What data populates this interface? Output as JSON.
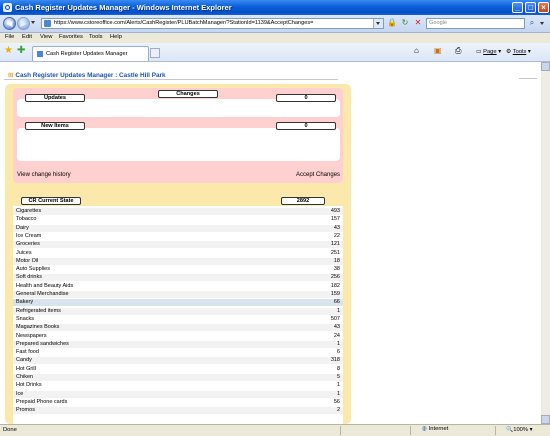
{
  "window": {
    "title": "Cash Register Updates Manager - Windows Internet Explorer"
  },
  "address": {
    "url": "https://www.cstoreoffice.com/Alerts/CashRegister/PLUBatchManager/?StationId=1139&AcceptChanges=",
    "search_placeholder": "Google"
  },
  "menu": [
    "File",
    "Edit",
    "View",
    "Favorites",
    "Tools",
    "Help"
  ],
  "tab": {
    "label": "Cash Register Updates Manager"
  },
  "commands": {
    "page": "Page",
    "tools": "Tools"
  },
  "page": {
    "title": "Cash Register Updates Manager : Castle Hill Park",
    "changes_label": "Changes",
    "updates_label": "Updates",
    "updates_count": "0",
    "new_items_label": "New Items",
    "new_items_count": "0",
    "view_history": "View change history",
    "accept_changes": "Accept Changes",
    "current_state_label": "CR Current State",
    "current_state_total": "2892",
    "categories": [
      {
        "name": "Cigarettes",
        "count": "493"
      },
      {
        "name": "Tobacco",
        "count": "157"
      },
      {
        "name": "Dairy",
        "count": "43"
      },
      {
        "name": "Ice Cream",
        "count": "22"
      },
      {
        "name": "Groceries",
        "count": "121"
      },
      {
        "name": "Juices",
        "count": "251"
      },
      {
        "name": "Motor Oil",
        "count": "18"
      },
      {
        "name": "Auto Supplies",
        "count": "38"
      },
      {
        "name": "Soft drinks",
        "count": "256"
      },
      {
        "name": "Health and Beauty Aids",
        "count": "182"
      },
      {
        "name": "General Merchandise",
        "count": "159"
      },
      {
        "name": "Bakery",
        "count": "66"
      },
      {
        "name": "Refrigerated items",
        "count": "1"
      },
      {
        "name": "Snacks",
        "count": "507"
      },
      {
        "name": "Magazines Books",
        "count": "43"
      },
      {
        "name": "Newspapers",
        "count": "24"
      },
      {
        "name": "Prepared sandwiches",
        "count": "1"
      },
      {
        "name": "Fast food",
        "count": "6"
      },
      {
        "name": "Candy",
        "count": "318"
      },
      {
        "name": "Hot Grill",
        "count": "8"
      },
      {
        "name": "Chiken",
        "count": "5"
      },
      {
        "name": "Hot Drinks",
        "count": "1"
      },
      {
        "name": "Ice",
        "count": "1"
      },
      {
        "name": "Prepaid Phone cards",
        "count": "56"
      },
      {
        "name": "Promos",
        "count": "2"
      }
    ],
    "highlight_index": 11
  },
  "status": {
    "left": "Done",
    "zone": "Internet",
    "zoom": "100%"
  },
  "colors": {
    "outer_panel": "#fbe9ab",
    "changes_panel": "#ffd0d0",
    "row_alt": "#f2f2f2",
    "row_highlight": "#d9e3ec",
    "title_blue": "#1a55b0"
  }
}
